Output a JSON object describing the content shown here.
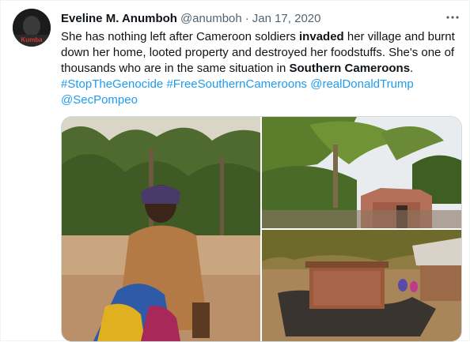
{
  "author": {
    "name": "Eveline M. Anumboh",
    "handle": "@anumboh",
    "separator": "·",
    "date": "Jan 17, 2020",
    "avatar_badge": "Kumba"
  },
  "more_icon": "more-horizontal-icon",
  "tweet": {
    "t1": "She has nothing left after Cameroon soldiers ",
    "b1": "invaded",
    "t2": " her village and burnt down her home, looted property and destroyed her foodstuffs. She's one of thousands who are in the same situation in ",
    "b2": "Southern Cameroons",
    "t3": ".",
    "links": [
      "#StopTheGenocide",
      "#FreeSouthernCameroons",
      "@realDonaldTrump",
      "@SecPompeo"
    ]
  },
  "colors": {
    "link": "#1d9bf0",
    "secondary_text": "#536471",
    "border": "#cfd9de"
  },
  "media": [
    {
      "subject": "woman-seated-photo"
    },
    {
      "subject": "burnt-house-banana-trees-photo"
    },
    {
      "subject": "burnt-brick-ruins-photo"
    }
  ]
}
